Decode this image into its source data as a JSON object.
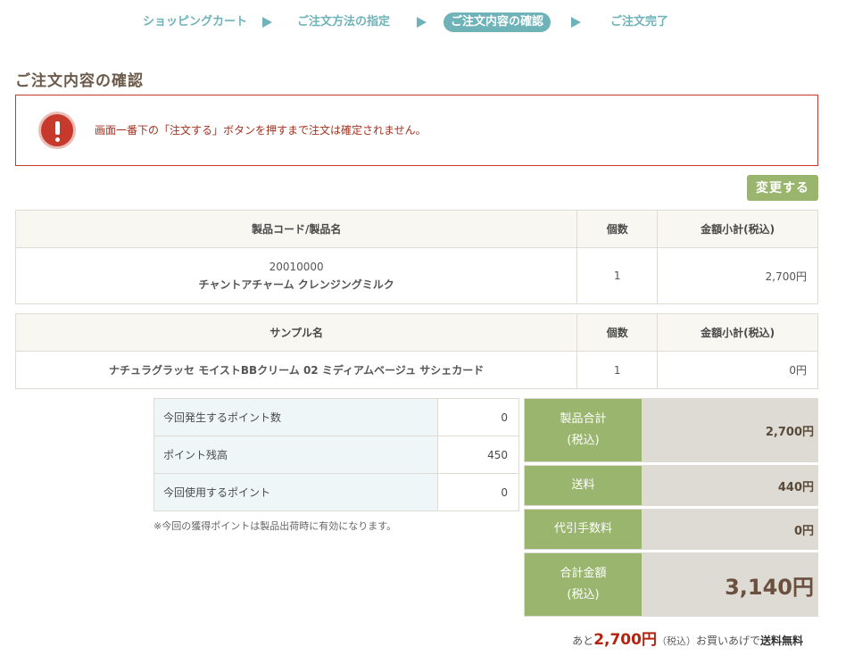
{
  "steps": {
    "step1": "ショッピングカート",
    "step2": "ご注文方法の指定",
    "step3": "ご注文内容の確認",
    "step4": "ご注文完了"
  },
  "page_title": "ご注文内容の確認",
  "alert": {
    "icon": "exclamation-icon",
    "text": "画面一番下の「注文する」ボタンを押すまで注文は確定されません。"
  },
  "change_button": "変更する",
  "products_table": {
    "headers": [
      "製品コード/製品名",
      "個数",
      "金額小計(税込)"
    ],
    "rows": [
      {
        "code": "20010000",
        "name": "チャントアチャーム クレンジングミルク",
        "qty": "1",
        "subtotal": "2,700円"
      }
    ]
  },
  "samples_table": {
    "headers": [
      "サンプル名",
      "個数",
      "金額小計(税込)"
    ],
    "rows": [
      {
        "name": "ナチュラグラッセ モイストBBクリーム 02 ミディアムベージュ サシェカード",
        "qty": "1",
        "subtotal": "0円"
      }
    ]
  },
  "points": {
    "rows": [
      {
        "label": "今回発生するポイント数",
        "value": "0"
      },
      {
        "label": "ポイント残高",
        "value": "450"
      },
      {
        "label": "今回使用するポイント",
        "value": "0"
      }
    ],
    "note": "※今回の獲得ポイントは製品出荷時に有効になります。"
  },
  "totals": {
    "product_total_label": "製品合計",
    "product_total_sub": "(税込)",
    "product_total_value": "2,700円",
    "shipping_label": "送料",
    "shipping_value": "440円",
    "cod_label": "代引手数料",
    "cod_value": "0円",
    "grand_total_label": "合計金額",
    "grand_total_sub": "(税込)",
    "grand_total_value": "3,140円"
  },
  "free_shipping": {
    "prefix": "あと",
    "amount": "2,700円",
    "tax": "（税込）",
    "middle": "お買いあげで",
    "suffix": "送料無料"
  },
  "colors": {
    "accent_teal": "#6fb3b8",
    "accent_green": "#9ab56e",
    "alert_red": "#c7392b"
  }
}
